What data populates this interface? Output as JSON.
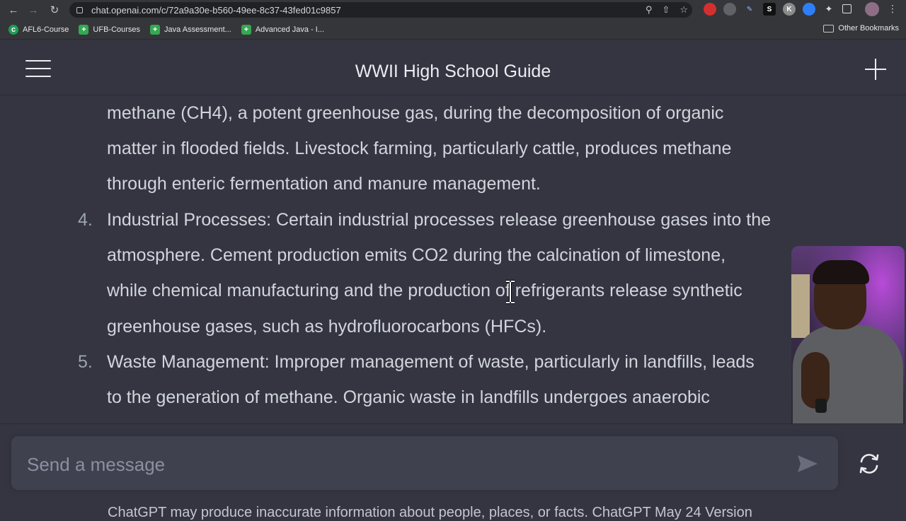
{
  "browser": {
    "url": "chat.openai.com/c/72a9a30e-b560-49ee-8c37-43fed01c9857",
    "bookmarks": [
      {
        "label": "AFL6-Course",
        "color": "#1f9d55",
        "icon_text": "c"
      },
      {
        "label": "UFB-Courses",
        "color": "#34a853",
        "icon_text": "+"
      },
      {
        "label": "Java Assessment...",
        "color": "#34a853",
        "icon_text": "+"
      },
      {
        "label": "Advanced Java - I...",
        "color": "#34a853",
        "icon_text": "+"
      }
    ],
    "other_bookmarks": "Other Bookmarks"
  },
  "header": {
    "title": "WWII High School Guide"
  },
  "content": {
    "lines": [
      "methane (CH4), a potent greenhouse gas, during the decomposition of organic",
      "matter in flooded fields. Livestock farming, particularly cattle, produces methane",
      "through enteric fermentation and manure management.",
      "Industrial Processes: Certain industrial processes release greenhouse gases into the",
      "atmosphere. Cement production emits CO2 during the calcination of limestone,",
      "while chemical manufacturing and the production of refrigerants release synthetic",
      "greenhouse gases, such as hydrofluorocarbons (HFCs).",
      "Waste Management: Improper management of waste, particularly in landfills, leads",
      "to the generation of methane. Organic waste in landfills undergoes anaerobic"
    ],
    "numbers": [
      "4.",
      "5."
    ]
  },
  "composer": {
    "placeholder": "Send a message",
    "disclaimer": "ChatGPT may produce inaccurate information about people, places, or facts. ChatGPT May 24 Version"
  }
}
